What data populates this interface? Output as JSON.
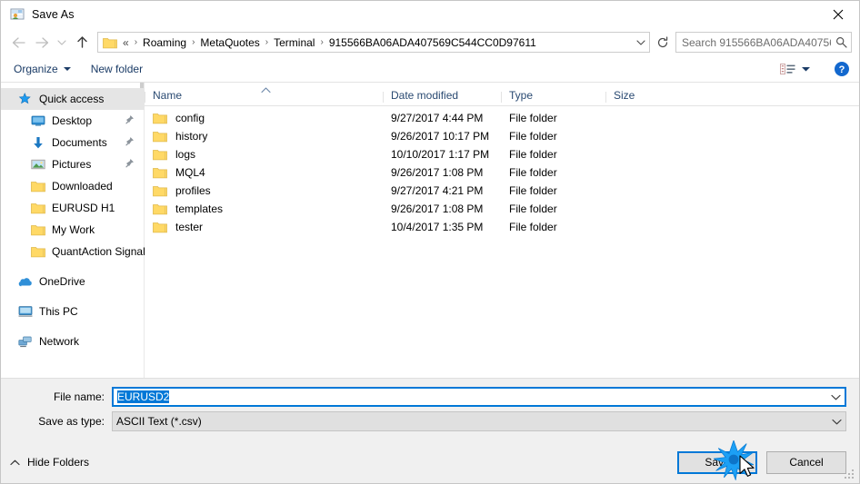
{
  "window": {
    "title": "Save As",
    "title_icon": "save-as-icon",
    "close_icon": "close-icon"
  },
  "navigation": {
    "back_icon": "back-arrow-icon",
    "forward_icon": "forward-arrow-icon",
    "recent_icon": "chevron-down-icon",
    "up_icon": "up-arrow-icon",
    "address_folder_icon": "folder-icon",
    "breadcrumb_prefix": "«",
    "breadcrumbs": [
      "Roaming",
      "MetaQuotes",
      "Terminal",
      "915566BA06ADA407569C544CC0D97611"
    ],
    "separator": "›",
    "address_chevron_icon": "chevron-down-icon",
    "refresh_icon": "refresh-icon"
  },
  "search": {
    "placeholder": "Search 915566BA06ADA40756...",
    "icon": "search-icon"
  },
  "toolbar": {
    "organize_label": "Organize",
    "organize_caret_icon": "caret-down-icon",
    "new_folder_label": "New folder",
    "view_icon": "view-layout-icon",
    "view_caret_icon": "caret-down-icon",
    "help_icon": "help-icon"
  },
  "sidebar": {
    "items": [
      {
        "label": "Quick access",
        "icon": "star-icon",
        "selected": true,
        "indent": false,
        "pinned": false,
        "group": false
      },
      {
        "label": "Desktop",
        "icon": "desktop-icon",
        "selected": false,
        "indent": true,
        "pinned": true,
        "group": false
      },
      {
        "label": "Documents",
        "icon": "documents-icon",
        "selected": false,
        "indent": true,
        "pinned": true,
        "group": false
      },
      {
        "label": "Pictures",
        "icon": "pictures-icon",
        "selected": false,
        "indent": true,
        "pinned": true,
        "group": false
      },
      {
        "label": "Downloaded",
        "icon": "folder-icon",
        "selected": false,
        "indent": true,
        "pinned": false,
        "group": false
      },
      {
        "label": "EURUSD H1",
        "icon": "folder-icon",
        "selected": false,
        "indent": true,
        "pinned": false,
        "group": false
      },
      {
        "label": "My Work",
        "icon": "folder-icon",
        "selected": false,
        "indent": true,
        "pinned": false,
        "group": false
      },
      {
        "label": "QuantAction Signal",
        "icon": "folder-icon",
        "selected": false,
        "indent": true,
        "pinned": false,
        "group": false
      },
      {
        "label": "OneDrive",
        "icon": "onedrive-icon",
        "selected": false,
        "indent": false,
        "pinned": false,
        "group": true
      },
      {
        "label": "This PC",
        "icon": "this-pc-icon",
        "selected": false,
        "indent": false,
        "pinned": false,
        "group": true
      },
      {
        "label": "Network",
        "icon": "network-icon",
        "selected": false,
        "indent": false,
        "pinned": false,
        "group": true
      }
    ]
  },
  "filelist": {
    "columns": [
      "Name",
      "Date modified",
      "Type",
      "Size"
    ],
    "sort_column": "Name",
    "sort_direction": "ascending",
    "rows": [
      {
        "name": "config",
        "date": "9/27/2017 4:44 PM",
        "type": "File folder",
        "size": ""
      },
      {
        "name": "history",
        "date": "9/26/2017 10:17 PM",
        "type": "File folder",
        "size": ""
      },
      {
        "name": "logs",
        "date": "10/10/2017 1:17 PM",
        "type": "File folder",
        "size": ""
      },
      {
        "name": "MQL4",
        "date": "9/26/2017 1:08 PM",
        "type": "File folder",
        "size": ""
      },
      {
        "name": "profiles",
        "date": "9/27/2017 4:21 PM",
        "type": "File folder",
        "size": ""
      },
      {
        "name": "templates",
        "date": "9/26/2017 1:08 PM",
        "type": "File folder",
        "size": ""
      },
      {
        "name": "tester",
        "date": "10/4/2017 1:35 PM",
        "type": "File folder",
        "size": ""
      }
    ]
  },
  "form": {
    "file_name_label": "File name:",
    "file_name_value": "EURUSD2",
    "file_name_selected": true,
    "save_type_label": "Save as type:",
    "save_type_value": "ASCII Text (*.csv)",
    "dropdown_icon": "chevron-down-icon"
  },
  "buttons": {
    "hide_folders_label": "Hide Folders",
    "hide_folders_icon": "chevron-up-icon",
    "save_label": "Save",
    "cancel_label": "Cancel"
  },
  "colors": {
    "accent": "#0078d7",
    "folder_yellow": "#ffd966",
    "chrome": "#f0f0f0",
    "header_text": "#2a4a72"
  }
}
